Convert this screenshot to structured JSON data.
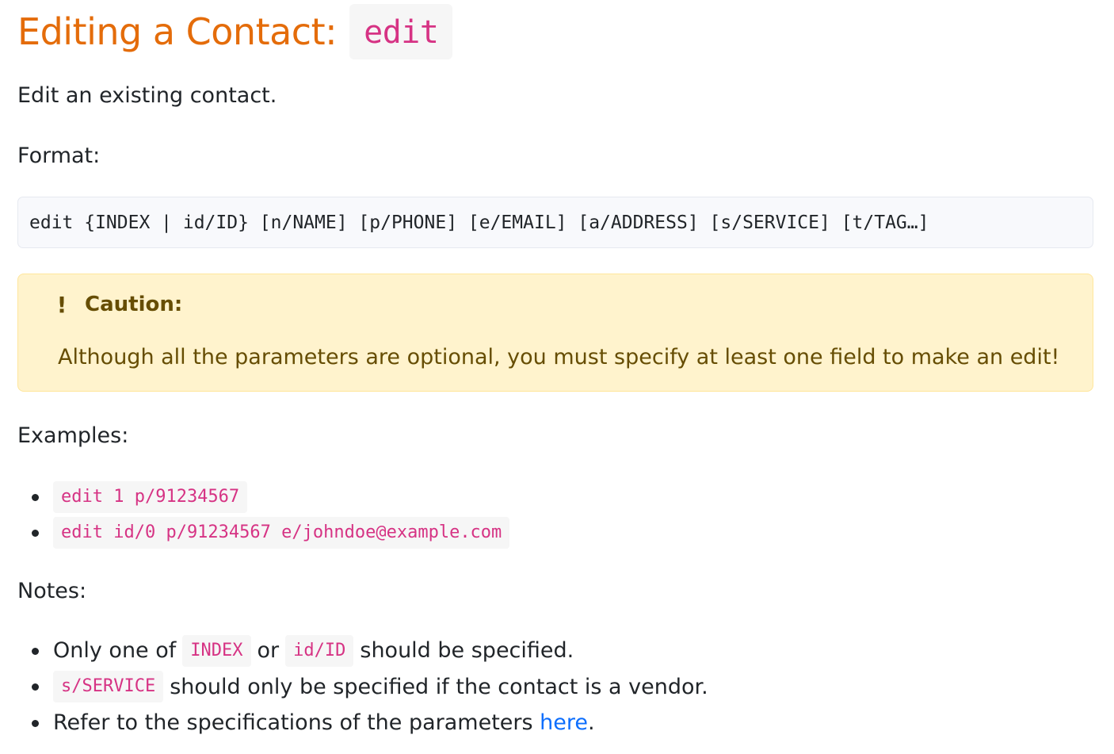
{
  "heading": {
    "text": "Editing a Contact:",
    "command": "edit"
  },
  "intro": "Edit an existing contact.",
  "format_label": "Format:",
  "format_code": "edit {INDEX | id/ID} [n/NAME] [p/PHONE] [e/EMAIL] [a/ADDRESS] [s/SERVICE] [t/TAG…]",
  "caution": {
    "icon": "exclamation-icon",
    "title": "Caution:",
    "body": "Although all the parameters are optional, you must specify at least one field to make an edit!"
  },
  "examples_label": "Examples:",
  "examples": [
    "edit 1 p/91234567",
    "edit id/0 p/91234567 e/johndoe@example.com"
  ],
  "notes_label": "Notes:",
  "notes": {
    "n1": {
      "pre": "Only one of",
      "code1": "INDEX",
      "mid": "or",
      "code2": "id/ID",
      "post": "should be specified."
    },
    "n2": {
      "code": "s/SERVICE",
      "post": "should only be specified if the contact is a vendor."
    },
    "n3": {
      "pre": "Refer to the specifications of the parameters",
      "link": "here",
      "post": "."
    }
  },
  "colors": {
    "heading": "#e46c0a",
    "inline_code": "#d63384",
    "caution_bg": "#fff3cd",
    "caution_text": "#664d03",
    "link": "#0d6efd"
  }
}
